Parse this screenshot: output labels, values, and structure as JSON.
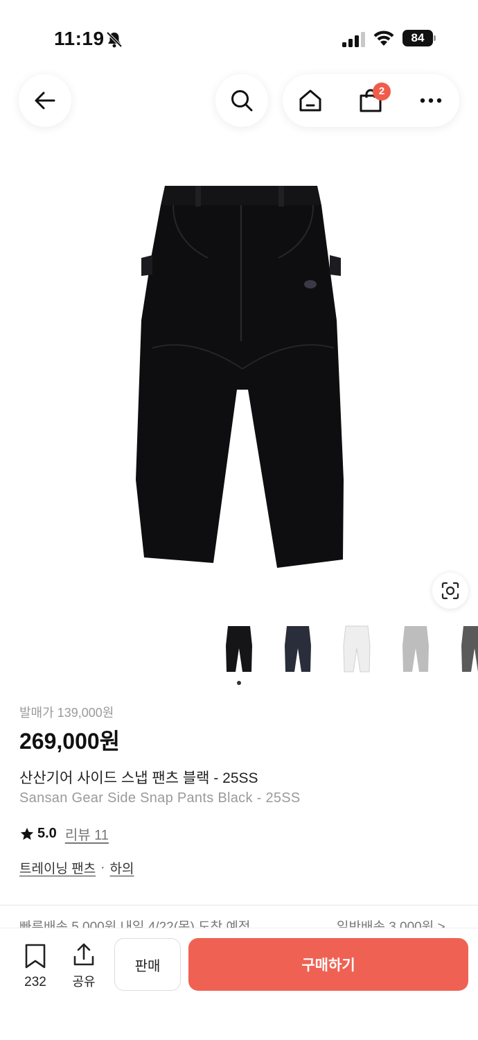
{
  "status_bar": {
    "time": "11:19",
    "battery": "84"
  },
  "nav": {
    "cart_badge": "2"
  },
  "thumbnails": [
    {
      "name": "black",
      "color": "#151518"
    },
    {
      "name": "navy",
      "color": "#2a2d3a"
    },
    {
      "name": "white",
      "color": "#eeeeee"
    },
    {
      "name": "grey",
      "color": "#bdbdbd"
    },
    {
      "name": "charcoal",
      "color": "#5a5a5a"
    }
  ],
  "product": {
    "release_price": "발매가 139,000원",
    "price": "269,000원",
    "title_ko": "산산기어 사이드 스냅 팬츠 블랙 - 25SS",
    "title_en": "Sansan Gear Side Snap Pants Black - 25SS",
    "rating": "5.0",
    "review_label": "리뷰 11",
    "category_1": "트레이닝 팬츠",
    "category_sep": "·",
    "category_2": "하의"
  },
  "shipping": {
    "fast": "빠른배송 5,000원 내일 4/22(목) 도착 예정",
    "normal": "일반배송 3,000원 >"
  },
  "bottom_bar": {
    "bookmark_count": "232",
    "share_label": "공유",
    "sell_label": "판매",
    "buy_label": "구매하기"
  },
  "colors": {
    "accent": "#ef6253",
    "badge": "#ef5d4a"
  }
}
